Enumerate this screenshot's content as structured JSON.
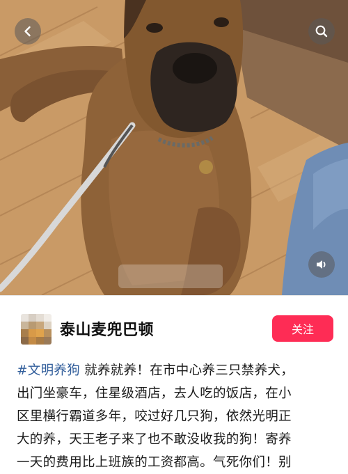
{
  "nav": {
    "back_icon": "chevron-left-icon",
    "search_icon": "search-icon",
    "volume_icon": "volume-icon"
  },
  "profile": {
    "username": "泰山麦兜巴顿",
    "follow_label": "关注",
    "follow_color": "#fe2c55"
  },
  "post": {
    "hashtag": "#文明养狗",
    "lines": [
      " 就养就养！在市中心养三只禁养犬，",
      "出门坐豪车，住星级酒店，去人吃的饭店，在小",
      "区里横行霸道多年，咬过好几只狗，依然光明正",
      "大的养，天王老子来了也不敢没收我的狗！寄养",
      "一天的费用比上班族的工资都高。气死你们！别"
    ],
    "hashtag_color": "#2f5c9a"
  }
}
